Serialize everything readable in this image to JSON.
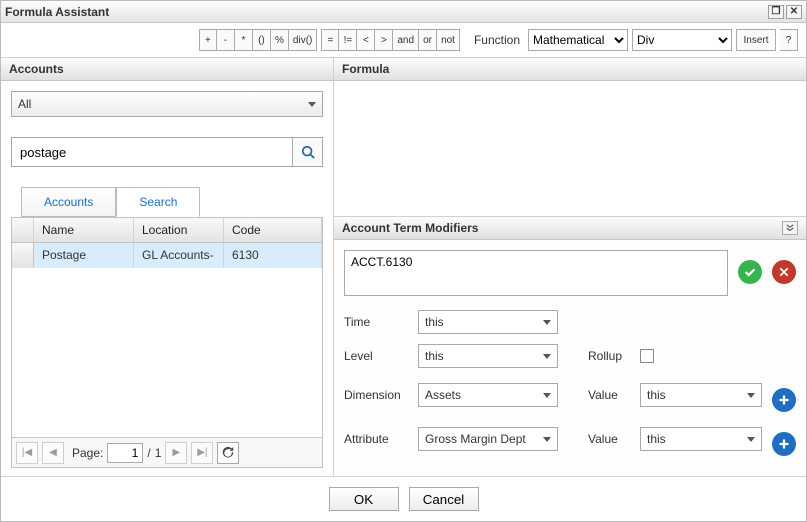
{
  "window": {
    "title": "Formula Assistant"
  },
  "toolbar": {
    "ops": [
      "+",
      "-",
      "*",
      "()",
      "%",
      "div()"
    ],
    "cmp": [
      "=",
      "!=",
      "<",
      ">",
      "and",
      "or",
      "not"
    ],
    "function_label": "Function",
    "function_group": "Mathematical",
    "function_name": "Div",
    "insert": "Insert",
    "help": "?"
  },
  "accounts": {
    "header": "Accounts",
    "selector": "All",
    "search_value": "postage",
    "tabs": {
      "accounts": "Accounts",
      "search": "Search"
    },
    "grid": {
      "cols": {
        "name": "Name",
        "location": "Location",
        "code": "Code"
      },
      "rows": [
        {
          "name": "Postage",
          "location": "GL Accounts-",
          "code": "6130"
        }
      ]
    },
    "pager": {
      "label": "Page:",
      "current": "1",
      "sep": "/",
      "total": "1"
    }
  },
  "formula": {
    "header": "Formula",
    "text": ""
  },
  "modifiers": {
    "header": "Account Term Modifiers",
    "account_term": "ACCT.6130",
    "rows": {
      "time": {
        "label": "Time",
        "value": "this"
      },
      "level": {
        "label": "Level",
        "value": "this",
        "rollup_label": "Rollup"
      },
      "dimension": {
        "label": "Dimension",
        "value": "Assets",
        "value_label": "Value",
        "value2": "this"
      },
      "attribute": {
        "label": "Attribute",
        "value": "Gross Margin Dept",
        "value_label": "Value",
        "value2": "this"
      }
    }
  },
  "footer": {
    "ok": "OK",
    "cancel": "Cancel"
  }
}
